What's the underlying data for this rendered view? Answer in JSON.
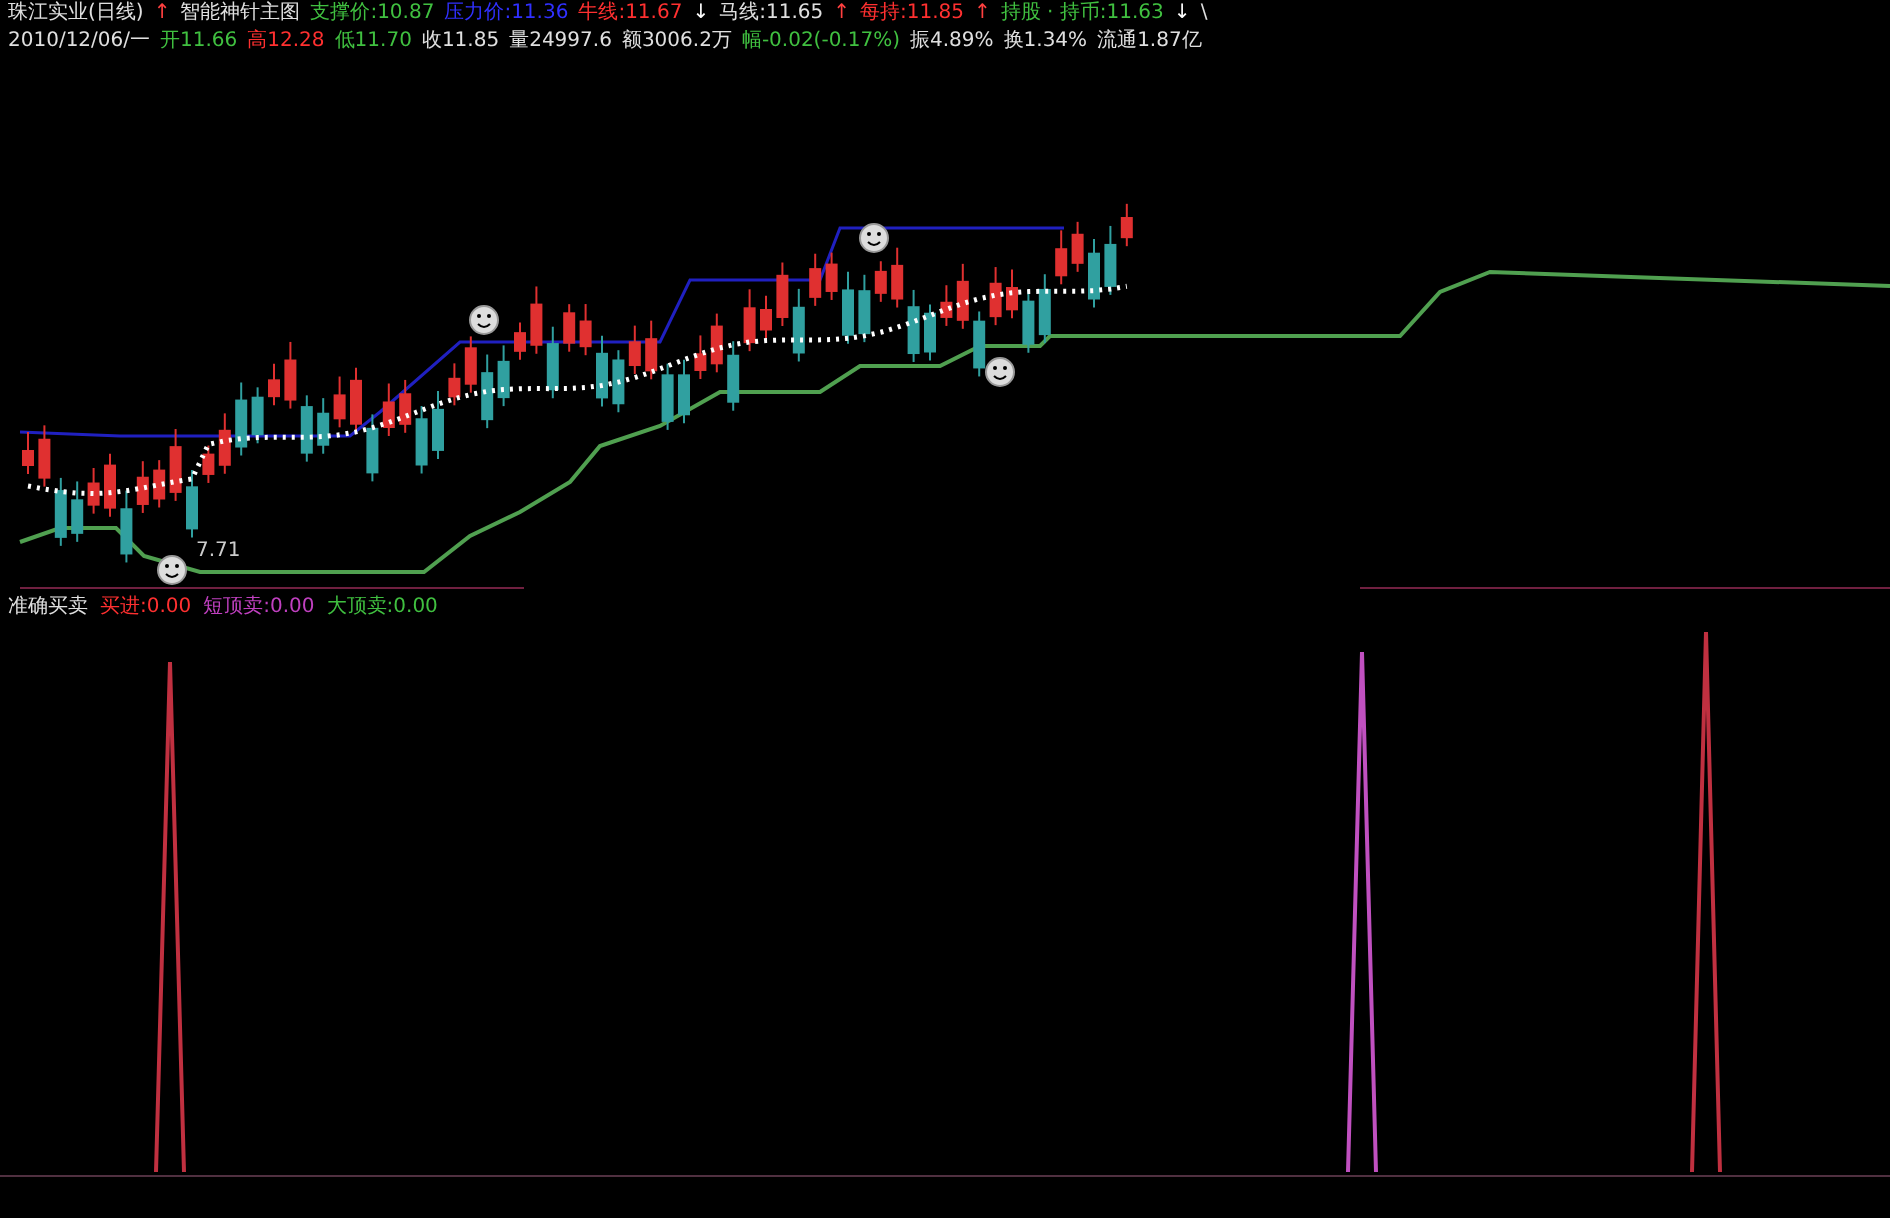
{
  "header": {
    "line_1": [
      {
        "text": "珠江实业(日线)",
        "color": "#e0e0e0"
      },
      {
        "text": "↑",
        "color": "#ff4040"
      },
      {
        "text": "智能神针主图",
        "color": "#e0e0e0"
      },
      {
        "text": "支撑价:10.87",
        "color": "#40c040"
      },
      {
        "text": "压力价:11.36",
        "color": "#3030ff"
      },
      {
        "text": "牛线:11.67",
        "color": "#ff3030"
      },
      {
        "text": "↓",
        "color": "#ffffff"
      },
      {
        "text": "马线:11.65",
        "color": "#e0e0e0"
      },
      {
        "text": "↑",
        "color": "#ff4040"
      },
      {
        "text": "每持:11.85",
        "color": "#ff3030"
      },
      {
        "text": "↑",
        "color": "#ff4040"
      },
      {
        "text": "持股 · 持币:11.63",
        "color": "#40c040"
      },
      {
        "text": "↓",
        "color": "#ffffff"
      },
      {
        "text": "\\",
        "color": "#e0e0e0"
      }
    ],
    "line_2": [
      {
        "text": "2010/12/06/一",
        "color": "#e0e0e0"
      },
      {
        "text": "开11.66",
        "color": "#40c040"
      },
      {
        "text": "高12.28",
        "color": "#ff3030"
      },
      {
        "text": "低11.70",
        "color": "#40c040"
      },
      {
        "text": "收11.85",
        "color": "#e0e0e0"
      },
      {
        "text": "量24997.6",
        "color": "#e0e0e0"
      },
      {
        "text": "额3006.2万",
        "color": "#e0e0e0"
      },
      {
        "text": "幅-0.02(-0.17%)",
        "color": "#40c040"
      },
      {
        "text": "振4.89%",
        "color": "#e0e0e0"
      },
      {
        "text": "换1.34%",
        "color": "#e0e0e0"
      },
      {
        "text": "流通1.87亿",
        "color": "#e0e0e0"
      }
    ]
  },
  "main_chart": {
    "low_label": "7.71"
  },
  "indicator": {
    "title": "准确买卖",
    "values": [
      {
        "text": "买进:0.00",
        "color": "#ff3030"
      },
      {
        "text": "短顶卖:0.00",
        "color": "#c040c0"
      },
      {
        "text": "大顶卖:0.00",
        "color": "#40c040"
      }
    ]
  }
}
